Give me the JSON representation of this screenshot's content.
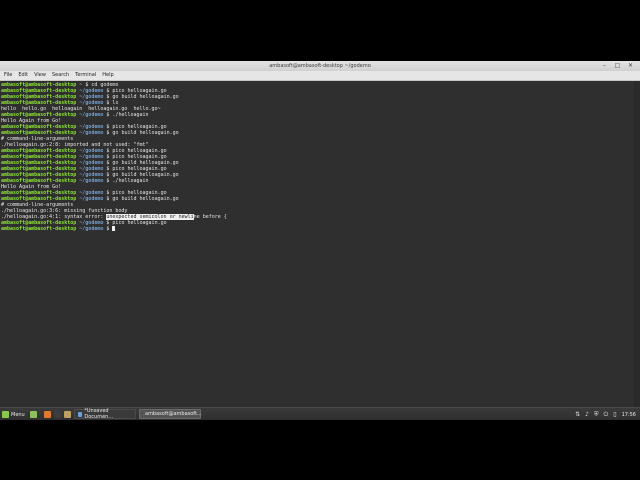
{
  "window": {
    "title": "ambasoft@ambasoft-desktop ~/godemo",
    "controls": [
      "minimize-icon",
      "maximize-icon",
      "close-icon"
    ]
  },
  "menubar": [
    "File",
    "Edit",
    "View",
    "Search",
    "Terminal",
    "Help"
  ],
  "prompt": {
    "user": "ambasoft@ambasoft-desktop",
    "path_home": "~",
    "path_godemo": "~/godemo",
    "symbol": "$"
  },
  "terminal": {
    "lines": [
      {
        "type": "cmd",
        "path": "~",
        "cmd": "cd godemo"
      },
      {
        "type": "cmd",
        "path": "~/godemo",
        "cmd": "pico helloagain.go"
      },
      {
        "type": "cmd",
        "path": "~/godemo",
        "cmd": "go build helloagain.go"
      },
      {
        "type": "cmd",
        "path": "~/godemo",
        "cmd": "ls"
      },
      {
        "type": "out",
        "text": "hello  hello.go  helloagain  helloagain.go  hello.go~"
      },
      {
        "type": "cmd",
        "path": "~/godemo",
        "cmd": "./helloagain"
      },
      {
        "type": "out",
        "text": "Hello Again from Go!"
      },
      {
        "type": "cmd",
        "path": "~/godemo",
        "cmd": "pico helloagain.go"
      },
      {
        "type": "cmd",
        "path": "~/godemo",
        "cmd": "go build helloagain.go"
      },
      {
        "type": "out",
        "text": "# command-line-arguments"
      },
      {
        "type": "out",
        "text": "./helloagain.go:2:8: imported and not used: \"fmt\""
      },
      {
        "type": "cmd",
        "path": "~/godemo",
        "cmd": "pico helloagain.go"
      },
      {
        "type": "cmd",
        "path": "~/godemo",
        "cmd": "pico helloagain.go"
      },
      {
        "type": "cmd",
        "path": "~/godemo",
        "cmd": "go build helloagain.go"
      },
      {
        "type": "cmd",
        "path": "~/godemo",
        "cmd": "pico helloagain.go"
      },
      {
        "type": "cmd",
        "path": "~/godemo",
        "cmd": "go build helloagain.go"
      },
      {
        "type": "cmd",
        "path": "~/godemo",
        "cmd": "./helloagain"
      },
      {
        "type": "out",
        "text": "Hello Again from Go!"
      },
      {
        "type": "cmd",
        "path": "~/godemo",
        "cmd": "pico helloagain.go"
      },
      {
        "type": "cmd",
        "path": "~/godemo",
        "cmd": "go build helloagain.go"
      },
      {
        "type": "out",
        "text": "# command-line-arguments"
      },
      {
        "type": "out",
        "text": "./helloagain.go:3:6: missing function body"
      },
      {
        "type": "err",
        "before": "./helloagain.go:4:1: syntax error: ",
        "selected": "unexpected semicolon or newli",
        "after": "ne before {"
      },
      {
        "type": "cmd",
        "path": "~/godemo",
        "cmd": "pico helloagain.go"
      },
      {
        "type": "cur",
        "path": "~/godemo"
      }
    ]
  },
  "taskbar": {
    "menu_label": "Menu",
    "launchers": [
      {
        "name": "show-desktop-icon",
        "color": "#8fbf5a"
      },
      {
        "name": "firefox-icon",
        "color": "#e07a2e"
      },
      {
        "name": "terminal-launcher-icon",
        "color": "#3d3d3d"
      },
      {
        "name": "files-icon",
        "color": "#c0a060"
      }
    ],
    "tasks": [
      {
        "label": "*Unsaved Documen...",
        "icon": "text-editor-icon",
        "color": "#6aa1d8",
        "active": false
      },
      {
        "label": "ambasoft@ambasoft...",
        "icon": "terminal-icon",
        "color": "#4a4a4a",
        "active": true
      }
    ],
    "tray_icons": [
      "network-icon",
      "volume-icon",
      "shield-icon",
      "power-icon",
      "battery-icon"
    ],
    "clock": "17:56"
  }
}
